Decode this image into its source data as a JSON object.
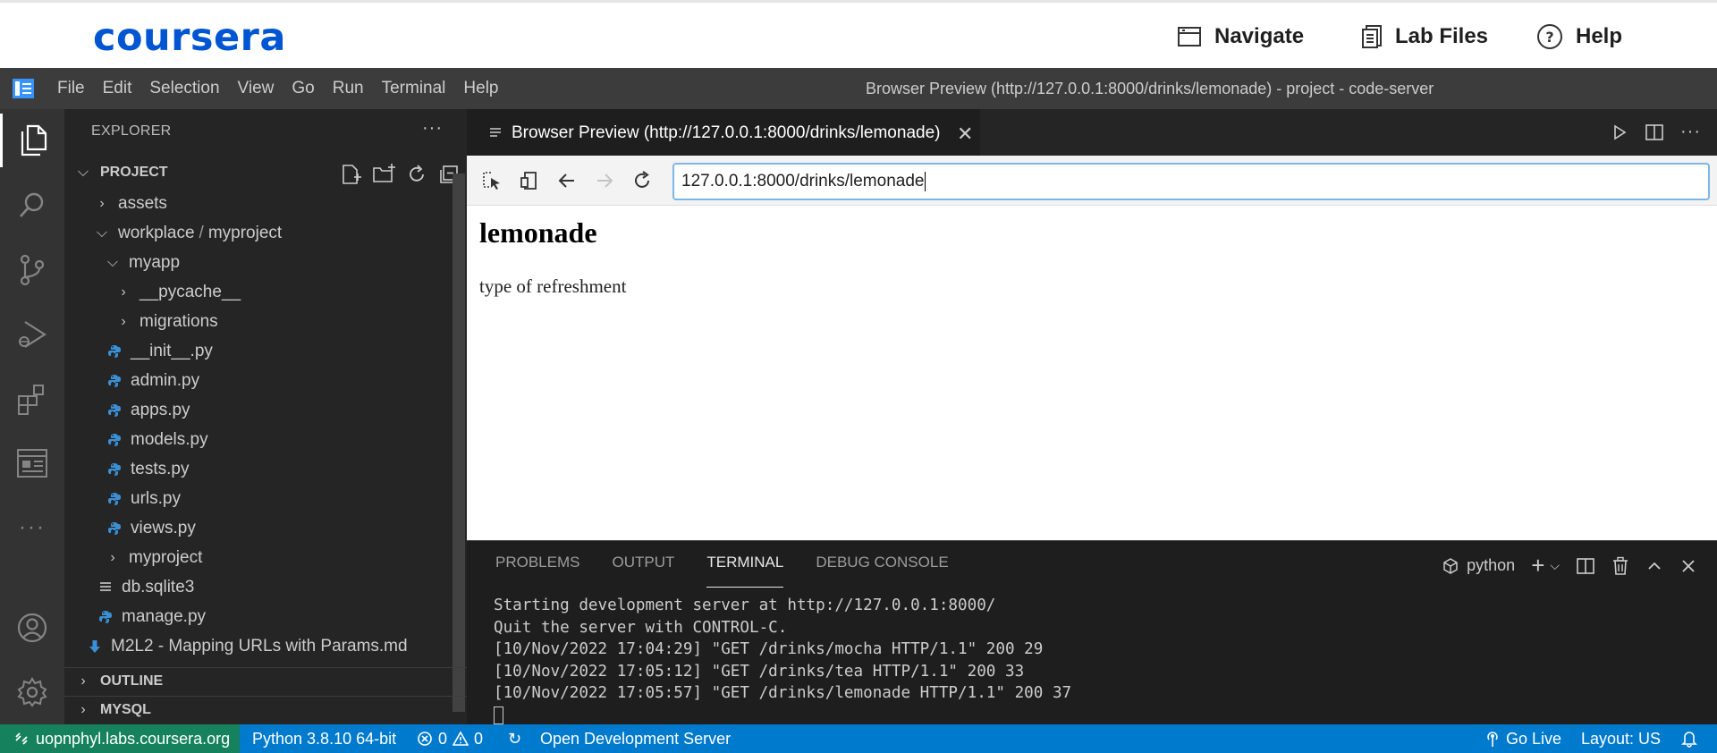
{
  "coursera": {
    "logo": "coursera",
    "nav": {
      "navigate": "Navigate",
      "lab_files": "Lab Files",
      "help": "Help"
    }
  },
  "titlebar": {
    "menu": [
      "File",
      "Edit",
      "Selection",
      "View",
      "Go",
      "Run",
      "Terminal",
      "Help"
    ],
    "title": "Browser Preview (http://127.0.0.1:8000/drinks/lemonade) - project - code-server"
  },
  "activity_bar": {
    "items": [
      "explorer-icon",
      "search-icon",
      "source-control-icon",
      "run-debug-icon",
      "extensions-icon",
      "browser-preview-icon",
      "more-icon"
    ],
    "bottom": [
      "account-icon",
      "settings-gear-icon"
    ]
  },
  "sidebar": {
    "title": "EXPLORER",
    "more": "···",
    "project_section": "PROJECT",
    "tree": [
      {
        "label": "assets",
        "type": "folder-collapsed"
      },
      {
        "label": "workplace",
        "label2": "myproject",
        "type": "folder-expanded"
      },
      {
        "label": "myapp",
        "type": "folder-expanded"
      },
      {
        "label": "__pycache__",
        "type": "folder-collapsed"
      },
      {
        "label": "migrations",
        "type": "folder-collapsed"
      },
      {
        "label": "__init__.py",
        "type": "python"
      },
      {
        "label": "admin.py",
        "type": "python"
      },
      {
        "label": "apps.py",
        "type": "python"
      },
      {
        "label": "models.py",
        "type": "python"
      },
      {
        "label": "tests.py",
        "type": "python"
      },
      {
        "label": "urls.py",
        "type": "python"
      },
      {
        "label": "views.py",
        "type": "python"
      },
      {
        "label": "myproject",
        "type": "folder-collapsed"
      },
      {
        "label": "db.sqlite3",
        "type": "file"
      },
      {
        "label": "manage.py",
        "type": "python"
      },
      {
        "label": "M2L2 - Mapping URLs with Params.md",
        "type": "markdown"
      }
    ],
    "outline_section": "OUTLINE",
    "mysql_section": "MYSQL"
  },
  "editor": {
    "tab_title": "Browser Preview (http://127.0.0.1:8000/drinks/lemonade)",
    "url": "127.0.0.1:8000/drinks/lemonade",
    "page_heading": "lemonade",
    "page_text": "type of refreshment"
  },
  "panel": {
    "tabs": [
      "PROBLEMS",
      "OUTPUT",
      "TERMINAL",
      "DEBUG CONSOLE"
    ],
    "active_tab": "TERMINAL",
    "terminal_name": "python",
    "terminal_lines": [
      "Starting development server at http://127.0.0.1:8000/",
      "Quit the server with CONTROL-C.",
      "[10/Nov/2022 17:04:29] \"GET /drinks/mocha HTTP/1.1\" 200 29",
      "[10/Nov/2022 17:05:12] \"GET /drinks/tea HTTP/1.1\" 200 33",
      "[10/Nov/2022 17:05:57] \"GET /drinks/lemonade HTTP/1.1\" 200 37"
    ]
  },
  "statusbar": {
    "remote": "uopnphyl.labs.coursera.org",
    "python": "Python 3.8.10 64-bit",
    "errors": "0",
    "warnings": "0",
    "sync": "↻",
    "open_server": "Open Development Server",
    "go_live": "Go Live",
    "layout": "Layout: US"
  },
  "colors": {
    "brand": "#0056d2",
    "statusbar": "#007acc",
    "remote": "#16825d",
    "activity_bar": "#333333",
    "sidebar": "#252526",
    "editor": "#1e1e1e"
  }
}
